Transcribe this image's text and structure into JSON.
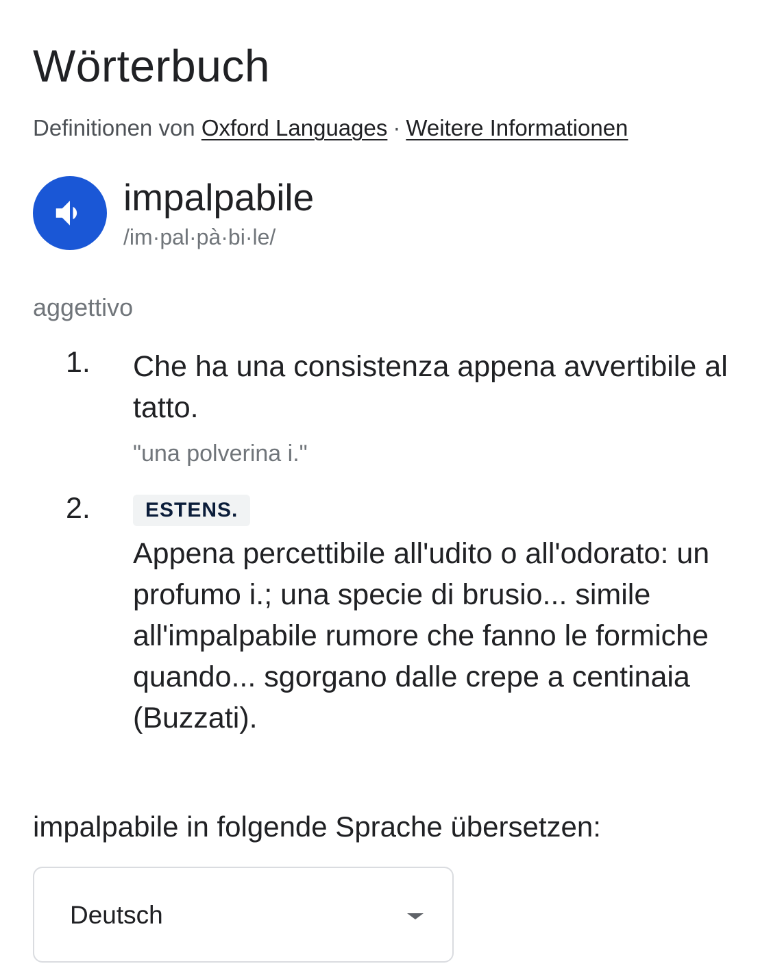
{
  "header": {
    "title": "Wörterbuch",
    "source_prefix": "Definitionen von",
    "source_link": "Oxford Languages",
    "separator": "·",
    "info_link": "Weitere Informationen"
  },
  "entry": {
    "headword": "impalpabile",
    "phonetic": "/im·pal·pà·bi·le/",
    "audio_icon": "speaker-icon",
    "audio_color": "#1a57d6",
    "part_of_speech": "aggettivo",
    "senses": [
      {
        "number": "1.",
        "label": "",
        "definition": "Che ha una consistenza appena avvertibile al tatto.",
        "example": "\"una polverina i.\""
      },
      {
        "number": "2.",
        "label": "ESTENS.",
        "definition": "Appena percettibile all'udito o all'odorato: un profumo i.; una specie di brusio... simile all'impalpabile rumore che fanno le formiche quando... sgorgano dalle crepe a centinaia (Buzzati).",
        "example": ""
      }
    ]
  },
  "translate": {
    "label": "impalpabile in folgende Sprache übersetzen:",
    "selected_language": "Deutsch",
    "dropdown_icon": "caret-down-icon"
  }
}
